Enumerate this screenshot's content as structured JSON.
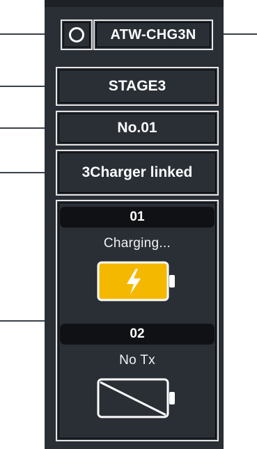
{
  "device": {
    "model": "ATW-CHG3N",
    "stage": "STAGE3",
    "number": "No.01",
    "linked_status": "3Charger linked"
  },
  "slots": [
    {
      "id": "01",
      "status": "Charging...",
      "battery_state": "charging",
      "battery_color": "#f5b800",
      "icon": "battery-charging-icon"
    },
    {
      "id": "02",
      "status": "No Tx",
      "battery_state": "empty",
      "icon": "battery-empty-icon"
    }
  ],
  "colors": {
    "panel_bg": "#2a2f36",
    "frame": "#e6e6e6",
    "text": "#ffffff",
    "charging": "#f5b800"
  }
}
